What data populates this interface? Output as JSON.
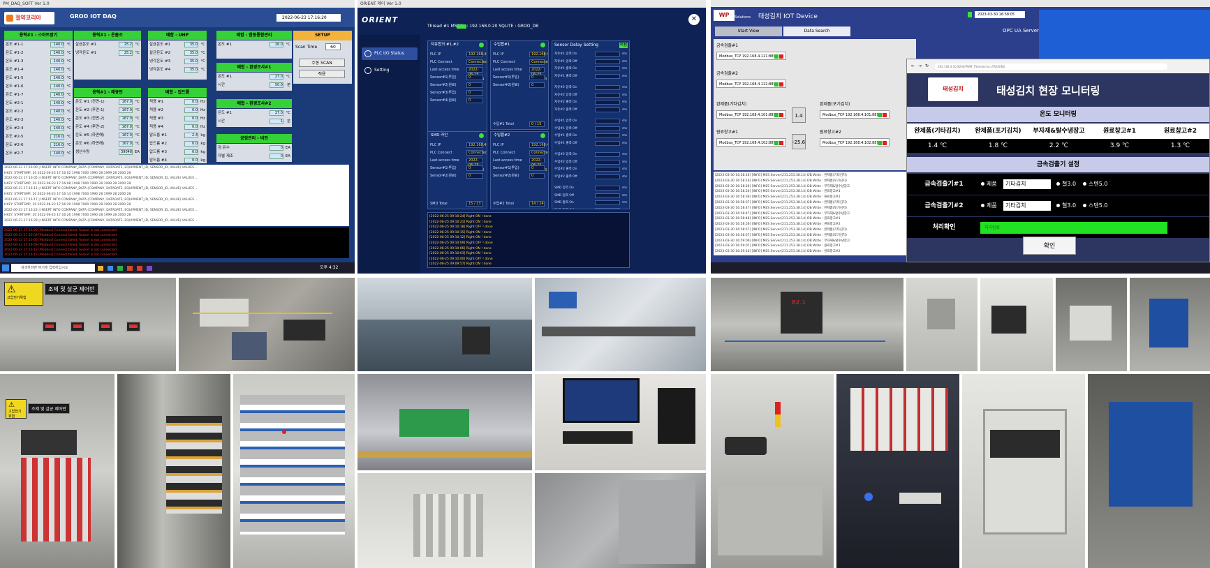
{
  "groo": {
    "window_title": "PM_DAQ_SOFT Ver 1.0",
    "logo_text": "절약코리아",
    "title": "GROO IOT DAQ",
    "clock": "2022-06-23 17:16:20",
    "groups": [
      {
        "title": "용혁#1 - 스마트팜기",
        "rows": [
          {
            "label": "온도 #1-1",
            "value": "140.0",
            "unit": "°C"
          },
          {
            "label": "온도 #1-2",
            "value": "140.0",
            "unit": "°C"
          },
          {
            "label": "온도 #1-3",
            "value": "140.0",
            "unit": "°C"
          },
          {
            "label": "온도 #1-4",
            "value": "140.0",
            "unit": "°C"
          },
          {
            "label": "온도 #1-5",
            "value": "140.0",
            "unit": "°C"
          },
          {
            "label": "온도 #1-6",
            "value": "140.0",
            "unit": "°C"
          },
          {
            "label": "온도 #1-7",
            "value": "140.0",
            "unit": "°C"
          },
          {
            "label": "온도 #2-1",
            "value": "140.0",
            "unit": "°C"
          },
          {
            "label": "온도 #2-2",
            "value": "140.0",
            "unit": "°C"
          },
          {
            "label": "온도 #2-3",
            "value": "140.0",
            "unit": "°C"
          },
          {
            "label": "온도 #2-4",
            "value": "140.0",
            "unit": "°C"
          },
          {
            "label": "온도 #2-5",
            "value": "216.0",
            "unit": "°C"
          },
          {
            "label": "온도 #2-6",
            "value": "216.0",
            "unit": "°C"
          },
          {
            "label": "온도 #2-7",
            "value": "140.0",
            "unit": "°C"
          }
        ]
      },
      {
        "title": "용혁#1 - 온흡조",
        "rows": [
          {
            "label": "살균온도 #1",
            "value": "25.2",
            "unit": "°C"
          },
          {
            "label": "냉각온도 #1",
            "value": "25.2",
            "unit": "°C"
          }
        ]
      },
      {
        "title": "배합 - UHP",
        "rows": [
          {
            "label": "살균온도 #1",
            "value": "35.0",
            "unit": "°C"
          },
          {
            "label": "살균온도 #2",
            "value": "35.0",
            "unit": "°C"
          },
          {
            "label": "냉각온도 #3",
            "value": "35.0",
            "unit": "°C"
          },
          {
            "label": "냉각온도 #4",
            "value": "35.0",
            "unit": "°C"
          }
        ]
      },
      {
        "title": "배합 - 합동통합관리",
        "rows": [
          {
            "label": "온도 #1",
            "value": "26.0",
            "unit": "°C"
          }
        ]
      },
      {
        "title": "용혁#1 - 레큐먼",
        "rows": [
          {
            "label": "온도 #1 (전면-1)",
            "value": "167.0",
            "unit": "°C"
          },
          {
            "label": "온도 #2 (후면-1)",
            "value": "167.0",
            "unit": "°C"
          },
          {
            "label": "온도 #3 (전면-2)",
            "value": "167.0",
            "unit": "°C"
          },
          {
            "label": "온도 #4 (후면-2)",
            "value": "167.0",
            "unit": "°C"
          },
          {
            "label": "온도 #5 (하면해)",
            "value": "167.0",
            "unit": "°C"
          },
          {
            "label": "온도 #6 (하면해)",
            "value": "167.0",
            "unit": "°C"
          },
          {
            "label": "생산수량",
            "value": "39048",
            "unit": "EA"
          }
        ]
      },
      {
        "title": "배합 - 압드름",
        "rows": [
          {
            "label": "적용 #1",
            "value": "0.0",
            "unit": "Hz"
          },
          {
            "label": "적용 #2",
            "value": "0.0",
            "unit": "Hz"
          },
          {
            "label": "적용 #3",
            "value": "0.0",
            "unit": "Hz"
          },
          {
            "label": "적용 #4",
            "value": "0.0",
            "unit": "Hz"
          },
          {
            "label": "압드름 #1",
            "value": "2.4",
            "unit": "kg"
          },
          {
            "label": "압드름 #2",
            "value": "0.0",
            "unit": "kg"
          },
          {
            "label": "압드름 #3",
            "value": "0.0",
            "unit": "kg"
          },
          {
            "label": "압드름 #4",
            "value": "0.0",
            "unit": "kg"
          }
        ]
      },
      {
        "title": "배합 - 환경조사#1",
        "rows": [
          {
            "label": "온도 #1",
            "value": "27.0",
            "unit": "°C"
          },
          {
            "label": "시간",
            "value": "50.0",
            "unit": "분"
          }
        ]
      },
      {
        "title": "배합 - 환경조사#2",
        "rows": [
          {
            "label": "온도 #1",
            "value": "27.0",
            "unit": "°C"
          },
          {
            "label": "시간",
            "value": "1",
            "unit": "분"
          }
        ]
      },
      {
        "title": "공정관리 - 비전",
        "rows": [
          {
            "label": "검 유수",
            "value": "0",
            "unit": "EA"
          },
          {
            "label": "자별 제조",
            "value": "0",
            "unit": "EA"
          }
        ]
      }
    ],
    "setup_label": "SETUP",
    "scan_label": "Scan Time",
    "scan_value": "60",
    "btn_scan": "수동 SCAN",
    "btn_close": "적용",
    "log_lines": [
      "2022-06-23 17:16:00 | INSERT INTO COMPANY_DATA (COMPANY, DATADATE, EQUIPMENT_ID, SENSOR_ID, VALUE) VALUES ...",
      "HKEY: STARTSMP, 20  2022-06-23 17:16:02  1998  7000  1990  28  1999  28  2000  28",
      "2022-06-23 17:16:05 | INSERT INTO COMPANY_DATA (COMPANY, DATADATE, EQUIPMENT_ID, SENSOR_ID, VALUE) VALUES ...",
      "HKEY: STARTSMP, 20  2022-06-23 17:16:08  1998  7000  1990  28  1999  28  2000  28",
      "2022-06-23 17:16:11 | INSERT INTO COMPANY_DATA (COMPANY, DATADATE, EQUIPMENT_ID, SENSOR_ID, VALUE) VALUES ...",
      "HKEY: STARTSMP, 20  2022-06-23 17:16:14  1998  7000  1990  28  1999  28  2000  28",
      "2022-06-23 17:16:17 | INSERT INTO COMPANY_DATA (COMPANY, DATADATE, EQUIPMENT_ID, SENSOR_ID, VALUE) VALUES ...",
      "HKEY: STARTSMP, 20  2022-06-23 17:16:20  1998  7000  1990  28  1999  28  2000  28",
      "2022-06-23 17:16:23 | INSERT INTO COMPANY_DATA (COMPANY, DATADATE, EQUIPMENT_ID, SENSOR_ID, VALUE) VALUES ...",
      "HKEY: STARTSMP, 20  2022-06-23 17:16:26  1998  7000  1990  28  1999  28  2000  28",
      "2022-06-23 17:16:29 | INSERT INTO COMPANY_DATA (COMPANY, DATADATE, EQUIPMENT_ID, SENSOR_ID, VALUE) VALUES ..."
    ],
    "err_lines": [
      "2022-06-23 17:16:00 [Modbus] Connect failed. Socket is not connected",
      "2022-06-23 17:16:03 [Modbus] Connect failed. Socket is not connected",
      "2022-06-23 17:16:06 [Modbus] Connect failed. Socket is not connected",
      "2022-06-23 17:16:09 [Modbus] Connect failed. Socket is not connected",
      "2022-06-23 17:16:12 [Modbus] Connect failed. Socket is not connected",
      "2022-06-23 17:16:15 [Modbus] Connect failed. Socket is not connected"
    ],
    "search_placeholder": "검색하려면 여기에 입력하십시오",
    "tray_time": "오후 4:32"
  },
  "orient": {
    "window_title": "ORIENT 제어 Ver 1.0",
    "brand": "ORIENT",
    "nav": [
      {
        "label": "PLC I/O Status"
      },
      {
        "label": "Setting"
      }
    ],
    "status": "Thread #1    MSSQL : 192.168.0.20      SQLITE : GROO_DB",
    "cards": [
      {
        "title": "자유합의 #1,#2",
        "rows": [
          {
            "label": "PLC IP",
            "value": "192.168.40.104"
          },
          {
            "label": "PLC Connect",
            "value": "Connected"
          },
          {
            "label": "Last access time",
            "value": "2022-06-25 09:10:24"
          },
          {
            "label": "Sensor#1(투입)",
            "value": "0"
          },
          {
            "label": "Sensor#2(완료)",
            "value": "0"
          },
          {
            "label": "Sensor#3(투입)",
            "value": "0"
          },
          {
            "label": "Sensor#4(완료)",
            "value": "0"
          },
          {
            "label": "자유#1 Total",
            "value": "0 / 0"
          },
          {
            "label": "자유#2 Total",
            "value": "0 / 0"
          }
        ]
      },
      {
        "title": "수입합#1",
        "rows": [
          {
            "label": "PLC IP",
            "value": "192.168.40.105"
          },
          {
            "label": "PLC Connect",
            "value": "Connected"
          },
          {
            "label": "Last access time",
            "value": "2022-06-25 09:10:23"
          },
          {
            "label": "Sensor#1(투입)",
            "value": "0"
          },
          {
            "label": "Sensor#2(완료)",
            "value": "0"
          },
          {
            "label": "수입#1 Total",
            "value": "0 / 15"
          }
        ]
      },
      {
        "title": "SMD 라인",
        "rows": [
          {
            "label": "PLC IP",
            "value": "192.168.40.107"
          },
          {
            "label": "PLC Connect",
            "value": "Connected"
          },
          {
            "label": "Last access time",
            "value": "2022-06-25 09:10:23"
          },
          {
            "label": "Sensor#1(투입)",
            "value": "0"
          },
          {
            "label": "Sensor#2(완료)",
            "value": "0"
          },
          {
            "label": "SMD Total",
            "value": "15 / 13"
          }
        ]
      },
      {
        "title": "수입합#2",
        "rows": [
          {
            "label": "PLC IP",
            "value": "192.168.40.106"
          },
          {
            "label": "PLC Connect",
            "value": "Connected"
          },
          {
            "label": "Last access time",
            "value": "2022-06-25 09:10:23"
          },
          {
            "label": "Sensor#1(투입)",
            "value": "0"
          },
          {
            "label": "Sensor#2(완료)",
            "value": "0"
          },
          {
            "label": "수입#2 Total",
            "value": "14 / 14"
          }
        ]
      }
    ],
    "delay_title": "Sensor Delay Setting",
    "delay_btn": "적용",
    "delay_rows": [
      "자유#1 입력 On",
      "자유#1 입력 Off",
      "자유#1 출력 On",
      "자유#1 출력 Off",
      "자유#2 입력 On",
      "자유#2 입력 Off",
      "자유#2 출력 On",
      "자유#2 출력 Off",
      "수입#1 입력 On",
      "수입#1 입력 Off",
      "수입#1 출력 On",
      "수입#1 출력 Off",
      "수입#2 입력 On",
      "수입#2 입력 Off",
      "수입#2 출력 On",
      "수입#2 출력 Off",
      "SMD 입력 On",
      "SMD 입력 Off",
      "SMD 출력 On",
      "SMD 출력 Off"
    ],
    "delay_unit": "ms",
    "monitor_lines": [
      "[2022-06-25 09:10:24] Right ON ! done",
      "[2022-06-25 09:10:21] Right ON ! done",
      "[2022-06-25 09:10:18] Right OFF ! done",
      "[2022-06-25 09:10:15] Right ON ! done",
      "[2022-06-25 09:10:12] Right ON ! done",
      "[2022-06-25 09:10:09] Right OFF ! done",
      "[2022-06-25 09:10:06] Right ON ! done",
      "[2022-06-25 09:10:03] Right ON ! done",
      "[2022-06-25 09:10:00] Right OFF ! done",
      "[2022-06-25 09:09:57] Right ON ! done"
    ]
  },
  "taesung": {
    "wp_logo": "WP",
    "wp_sub": "Solutions",
    "title": "태성김치 IOT Device",
    "time": "2023-03-30 16:58:05",
    "tab_start": "Start View",
    "tab_search": "Data Search",
    "opc": "OPC UA Server   opc.tcp://192.168.4.10:4842",
    "devices": [
      {
        "group": "금속검출#1",
        "label": "Modbus_TCP   192.168.4.121:8899"
      },
      {
        "group": "금속검출#2",
        "label": "Modbus_TCP   192.168.4.122:8899"
      },
      {
        "group": "완제품(기타김치)",
        "label": "Modbus_TCP   192.168.4.101:8899"
      },
      {
        "group": "원료창고#1",
        "label": "Modbus_TCP   192.168.4.102:8899"
      },
      {
        "group": "완제품(포기김치)",
        "label": "Modbus_TCP   192.168.4.101:8899"
      },
      {
        "group": "원료창고#2",
        "label": "Modbus_TCP   192.168.4.102:8899"
      }
    ],
    "num_1": "1.4",
    "num_2": "-25.6",
    "log_lines": [
      "[2023-03-30 16:58:16]  [INFO] MES Server(211.253.38.14) DB Write : 완제품(기타김치)",
      "[2023-03-30 16:58:16]  [INFO] MES Server(211.253.38.14) DB Write : 완제품(포기김치)",
      "[2023-03-30 16:58:26]  [INFO] MES Server(211.253.38.14) DB Write : 부자재&탈수냉장고",
      "[2023-03-30 16:58:26]  [INFO] MES Server(211.253.38.14) DB Write : 원료창고#1",
      "[2023-03-30 16:58:36]  [INFO] MES Server(211.253.38.14) DB Write : 원료창고#2",
      "[2023-03-30 16:58:37]  [INFO] MES Server(211.253.38.14) DB Write : 완제품(기타김치)",
      "[2023-03-30 16:58:47]  [INFO] MES Server(211.253.38.14) DB Write : 완제품(포기김치)",
      "[2023-03-30 16:58:47]  [INFO] MES Server(211.253.38.14) DB Write : 부자재&탈수냉장고",
      "[2023-03-30 16:58:48]  [INFO] MES Server(211.253.38.14) DB Write : 원료창고#1",
      "[2023-03-30 16:58:56]  [INFO] MES Server(211.253.38.14) DB Write : 원료창고#2",
      "[2023-03-30 16:58:57]  [INFO] MES Server(211.253.38.14) DB Write : 완제품(기타김치)",
      "[2023-03-30 16:58:57]  [INFO] MES Server(211.253.38.14) DB Write : 완제품(포기김치)",
      "[2023-03-30 16:59:06]  [INFO] MES Server(211.253.38.14) DB Write : 부자재&탈수냉장고",
      "[2023-03-30 16:59:07]  [INFO] MES Server(211.253.38.14) DB Write : 원료창고#1",
      "[2023-03-30 16:59:16]  [INFO] MES Server(211.253.38.14) DB Write : 원료창고#2"
    ],
    "url": "192.168.4.10:8200/PWM_TS/index?ui=TAESUNG",
    "kimchi_logo": "태성김치",
    "monitor_title": "태성김치 현장 모니터링",
    "temp_section": "온도 모니터링",
    "temp_cols": [
      {
        "head": "완제품(기타김치)",
        "val": "1.4 ℃"
      },
      {
        "head": "완제품(포기김치)",
        "val": "1.8 ℃"
      },
      {
        "head": "부자재&탈수냉장고",
        "val": "2.2 ℃"
      },
      {
        "head": "원료창고#1",
        "val": "3.9 ℃"
      },
      {
        "head": "원료창고#2",
        "val": "1.3 ℃"
      }
    ],
    "metal_section": "금속검출기 설정",
    "detectors": [
      {
        "label": "금속검출기#1",
        "product": "제품",
        "selected": "기타김치",
        "iron": "철3.0",
        "steel": "스텐5.0"
      },
      {
        "label": "금속검출기#2",
        "product": "제품",
        "selected": "기타김치",
        "iron": "철3.0",
        "steel": "스텐5.0"
      }
    ],
    "confirm_label": "처리확인",
    "confirm_status": "처리완료",
    "confirm_button": "확인"
  },
  "photos": {
    "sign_1": "고압전기위험",
    "plate_1": "조제 및 살균 제어반",
    "sign_2": "고압전기위험",
    "plate_2": "조제 및 살균 제어반",
    "counter": "82.1"
  }
}
